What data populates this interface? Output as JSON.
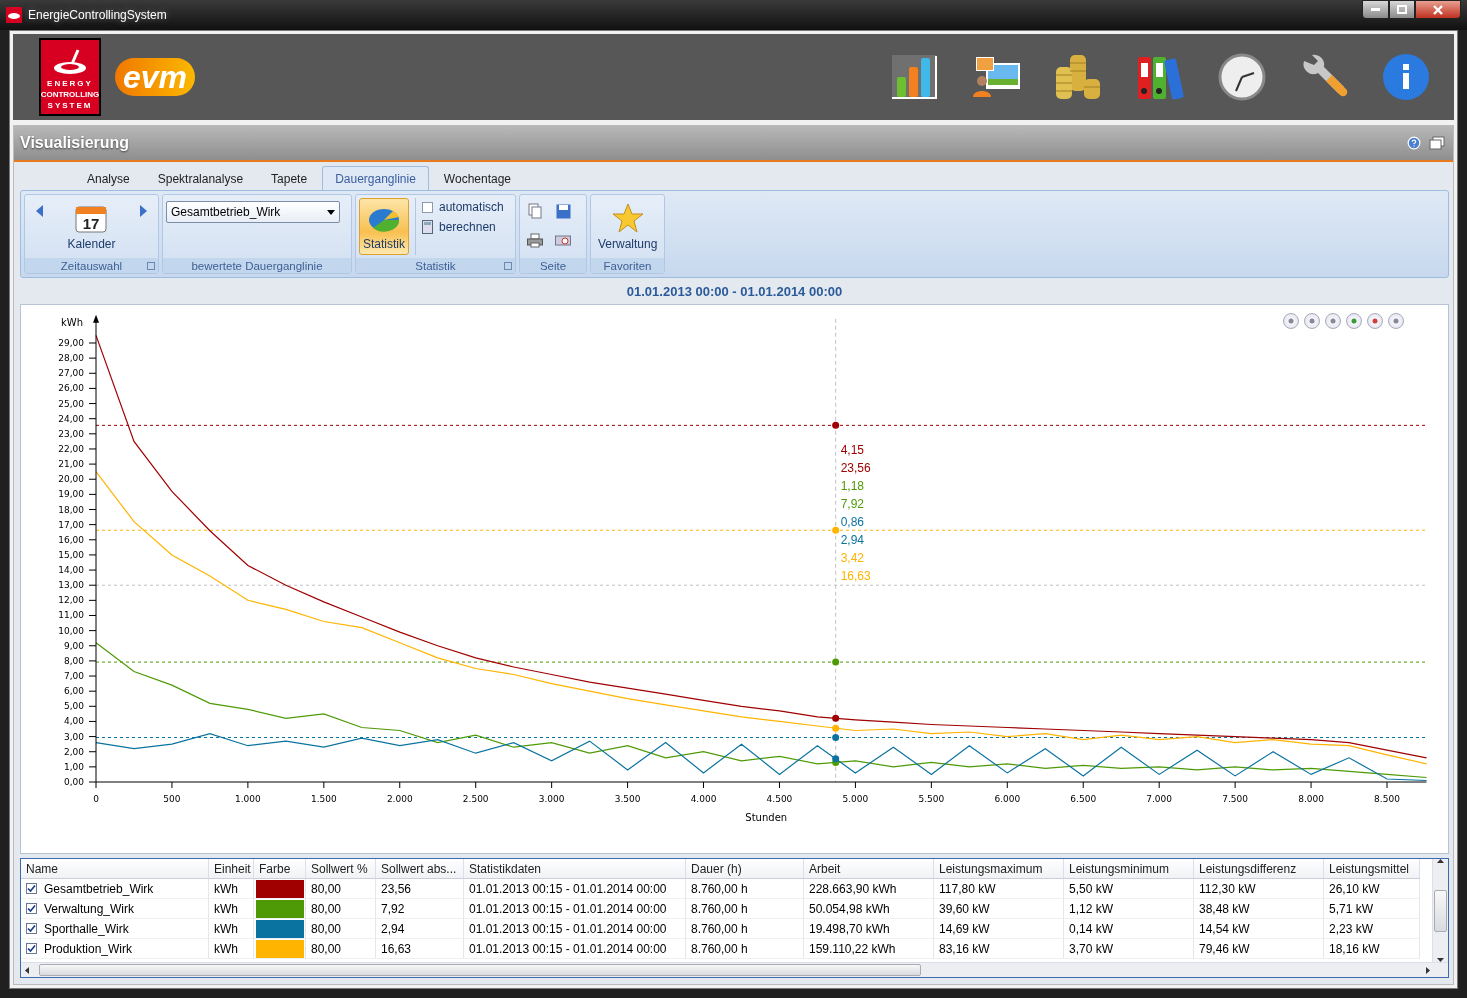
{
  "window": {
    "title": "EnergieControllingSystem"
  },
  "header": {
    "logo_lines": [
      "ENERGY",
      "CONTROLLING",
      "SYSTEM"
    ],
    "brand": "evm"
  },
  "module": {
    "title": "Visualisierung"
  },
  "tabs": [
    {
      "label": "Analyse",
      "selected": false
    },
    {
      "label": "Spektralanalyse",
      "selected": false
    },
    {
      "label": "Tapete",
      "selected": false
    },
    {
      "label": "Dauerganglinie",
      "selected": true
    },
    {
      "label": "Wochentage",
      "selected": false
    }
  ],
  "ribbon": {
    "zeitauswahl": {
      "day": "17",
      "button": "Kalender",
      "label": "Zeitauswahl"
    },
    "dauerganglinie": {
      "combo": "Gesamtbetrieb_Wirk",
      "label": "bewertete Dauerganglinie"
    },
    "statistik": {
      "button": "Statistik",
      "pressed": true,
      "checkbox": {
        "label": "automatisch",
        "checked": false
      },
      "action": "berechnen",
      "label": "Statistik"
    },
    "seite": {
      "label": "Seite"
    },
    "favoriten": {
      "button": "Verwaltung",
      "label": "Favoriten"
    }
  },
  "range": "01.01.2013 00:00 - 01.01.2014 00:00",
  "chart": {
    "chart_data": {
      "type": "line",
      "xlabel": "Stunden",
      "ylabel": "kWh",
      "xlim": [
        0,
        8760
      ],
      "ylim": [
        0,
        30.6
      ],
      "x": [
        0,
        250,
        500,
        750,
        1000,
        1250,
        1500,
        1750,
        2000,
        2250,
        2500,
        2750,
        3000,
        3250,
        3500,
        3750,
        4000,
        4250,
        4500,
        4750,
        5000,
        5250,
        5500,
        5750,
        6000,
        6250,
        6500,
        6750,
        7000,
        7250,
        7500,
        7750,
        8000,
        8250,
        8500,
        8760
      ],
      "series": [
        {
          "color": "#a00000",
          "values": [
            29.5,
            22.5,
            19.2,
            16.6,
            14.3,
            13.0,
            11.9,
            10.9,
            9.9,
            9.0,
            8.2,
            7.6,
            7.1,
            6.6,
            6.2,
            5.8,
            5.4,
            5.0,
            4.7,
            4.3,
            4.1,
            3.95,
            3.8,
            3.7,
            3.6,
            3.5,
            3.4,
            3.3,
            3.2,
            3.1,
            3.0,
            2.9,
            2.8,
            2.6,
            2.1,
            1.6
          ]
        },
        {
          "color": "#4e9a06",
          "values": [
            9.2,
            7.3,
            6.4,
            5.2,
            4.8,
            4.2,
            4.5,
            3.6,
            3.4,
            2.6,
            3.1,
            2.3,
            2.6,
            1.9,
            2.4,
            1.6,
            2.0,
            1.4,
            1.7,
            1.2,
            1.4,
            1.0,
            1.3,
            1.0,
            1.2,
            0.9,
            1.1,
            0.9,
            1.0,
            0.8,
            1.0,
            0.8,
            0.9,
            0.7,
            0.5,
            0.3
          ]
        },
        {
          "color": "#0a73a0",
          "values": [
            2.6,
            2.2,
            2.5,
            3.2,
            2.4,
            2.7,
            2.3,
            2.9,
            2.4,
            2.8,
            1.9,
            2.6,
            1.4,
            2.7,
            0.8,
            2.6,
            0.6,
            2.5,
            0.5,
            2.4,
            0.6,
            2.3,
            0.5,
            2.4,
            0.6,
            2.2,
            0.4,
            2.3,
            0.5,
            2.1,
            0.4,
            2.0,
            0.5,
            1.6,
            0.2,
            0.1
          ]
        },
        {
          "color": "#ffb400",
          "values": [
            20.5,
            17.2,
            15.0,
            13.6,
            12.0,
            11.4,
            10.6,
            10.2,
            9.2,
            8.2,
            7.5,
            7.1,
            6.5,
            6.0,
            5.5,
            5.1,
            4.7,
            4.3,
            4.0,
            3.7,
            3.4,
            3.5,
            3.2,
            3.3,
            3.0,
            3.2,
            2.8,
            3.1,
            2.8,
            3.0,
            2.6,
            2.8,
            2.5,
            2.4,
            1.8,
            1.2
          ]
        }
      ],
      "xticks": [
        {
          "value": 0,
          "label": "0"
        },
        {
          "value": 500,
          "label": "500"
        },
        {
          "value": 1000,
          "label": "1.000"
        },
        {
          "value": 1500,
          "label": "1.500"
        },
        {
          "value": 2000,
          "label": "2.000"
        },
        {
          "value": 2500,
          "label": "2.500"
        },
        {
          "value": 3000,
          "label": "3.000"
        },
        {
          "value": 3500,
          "label": "3.500"
        },
        {
          "value": 4000,
          "label": "4.000"
        },
        {
          "value": 4500,
          "label": "4.500"
        },
        {
          "value": 5000,
          "label": "5.000"
        },
        {
          "value": 5500,
          "label": "5.500"
        },
        {
          "value": 6000,
          "label": "6.000"
        },
        {
          "value": 6500,
          "label": "6.500"
        },
        {
          "value": 7000,
          "label": "7.000"
        },
        {
          "value": 7500,
          "label": "7.500"
        },
        {
          "value": 8000,
          "label": "8.000"
        },
        {
          "value": 8500,
          "label": "8.500"
        }
      ],
      "yticks": [
        {
          "value": 0,
          "label": "0,00"
        },
        {
          "value": 1,
          "label": "1,00"
        },
        {
          "value": 2,
          "label": "2,00"
        },
        {
          "value": 3,
          "label": "3,00"
        },
        {
          "value": 4,
          "label": "4,00"
        },
        {
          "value": 5,
          "label": "5,00"
        },
        {
          "value": 6,
          "label": "6,00"
        },
        {
          "value": 7,
          "label": "7,00"
        },
        {
          "value": 8,
          "label": "8,00"
        },
        {
          "value": 9,
          "label": "9,00"
        },
        {
          "value": 10,
          "label": "10,00"
        },
        {
          "value": 11,
          "label": "11,00"
        },
        {
          "value": 12,
          "label": "12,00"
        },
        {
          "value": 13,
          "label": "13,00"
        },
        {
          "value": 14,
          "label": "14,00"
        },
        {
          "value": 15,
          "label": "15,00"
        },
        {
          "value": 16,
          "label": "16,00"
        },
        {
          "value": 17,
          "label": "17,00"
        },
        {
          "value": 18,
          "label": "18,00"
        },
        {
          "value": 19,
          "label": "19,00"
        },
        {
          "value": 20,
          "label": "20,00"
        },
        {
          "value": 21,
          "label": "21,00"
        },
        {
          "value": 22,
          "label": "22,00"
        },
        {
          "value": 23,
          "label": "23,00"
        },
        {
          "value": 24,
          "label": "24,00"
        },
        {
          "value": 25,
          "label": "25,00"
        },
        {
          "value": 26,
          "label": "26,00"
        },
        {
          "value": 27,
          "label": "27,00"
        },
        {
          "value": 28,
          "label": "28,00"
        },
        {
          "value": 29,
          "label": "29,00"
        }
      ],
      "ref_lines": [
        {
          "axis": "y",
          "value": 23.56,
          "color": "#a00000"
        },
        {
          "axis": "y",
          "value": 16.63,
          "color": "#ffb400"
        },
        {
          "axis": "y",
          "value": 13,
          "color": "#c0c0c0"
        },
        {
          "axis": "y",
          "value": 7.92,
          "color": "#4e9a06"
        },
        {
          "axis": "y",
          "value": 2.94,
          "color": "#0a73a0"
        },
        {
          "axis": "x",
          "value": 4870,
          "color": "#c0c0c0"
        }
      ]
    },
    "cursor": {
      "labels": [
        {
          "text": "4,15",
          "color": "#a00000"
        },
        {
          "text": "23,56",
          "color": "#a00000"
        },
        {
          "text": "1,18",
          "color": "#4e9a06"
        },
        {
          "text": "7,92",
          "color": "#4e9a06"
        },
        {
          "text": "0,86",
          "color": "#0a73a0"
        },
        {
          "text": "2,94",
          "color": "#0a73a0"
        },
        {
          "text": "3,42",
          "color": "#ffb400"
        },
        {
          "text": "16,63",
          "color": "#ffb400"
        }
      ]
    }
  },
  "table": {
    "columns": [
      "Name",
      "Einheit",
      "Farbe",
      "Sollwert %",
      "Sollwert abs...",
      "Statistikdaten",
      "Dauer (h)",
      "Arbeit",
      "Leistungsmaximum",
      "Leistungsminimum",
      "Leistungsdifferenz",
      "Leistungsmittel"
    ],
    "rows": [
      {
        "checked": true,
        "color": "#a00000",
        "cells": [
          "Gesamtbetrieb_Wirk",
          "kWh",
          "",
          "80,00",
          "23,56",
          "01.01.2013 00:15 - 01.01.2014 00:00",
          "8.760,00 h",
          "228.663,90 kWh",
          "117,80 kW",
          "5,50 kW",
          "112,30 kW",
          "26,10 kW"
        ]
      },
      {
        "checked": true,
        "color": "#4e9a06",
        "cells": [
          "Verwaltung_Wirk",
          "kWh",
          "",
          "80,00",
          "7,92",
          "01.01.2013 00:15 - 01.01.2014 00:00",
          "8.760,00 h",
          "50.054,98 kWh",
          "39,60 kW",
          "1,12 kW",
          "38,48 kW",
          "5,71 kW"
        ]
      },
      {
        "checked": true,
        "color": "#0a73a0",
        "cells": [
          "Sporthalle_Wirk",
          "kWh",
          "",
          "80,00",
          "2,94",
          "01.01.2013 00:15 - 01.01.2014 00:00",
          "8.760,00 h",
          "19.498,70 kWh",
          "14,69 kW",
          "0,14 kW",
          "14,54 kW",
          "2,23 kW"
        ]
      },
      {
        "checked": true,
        "color": "#ffb400",
        "cells": [
          "Produktion_Wirk",
          "kWh",
          "",
          "80,00",
          "16,63",
          "01.01.2013 00:15 - 01.01.2014 00:00",
          "8.760,00 h",
          "159.110,22 kWh",
          "83,16 kW",
          "3,70 kW",
          "79,46 kW",
          "18,16 kW"
        ]
      }
    ]
  }
}
